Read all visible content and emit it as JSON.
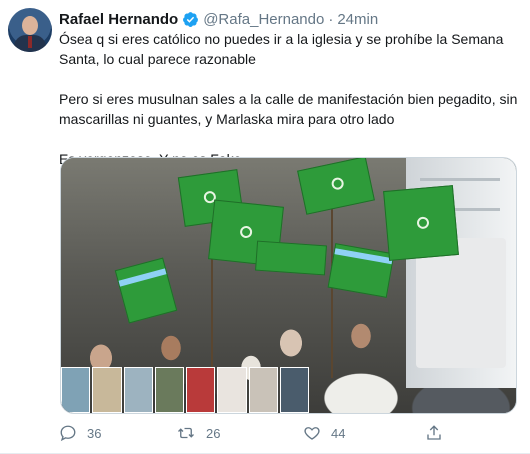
{
  "tweet": {
    "author_name": "Rafael Hernando",
    "handle": "@Rafa_Hernando",
    "separator": "·",
    "time": "24min",
    "paragraphs": [
      "Ósea q si eres católico no puedes ir a la iglesia y se prohíbe la Semana Santa, lo cual parece razonable",
      "Pero si eres musulnan sales a la calle de manifestación bien pegadito, sin mascarillas ni guantes, y Marlaska mira para  otro lado",
      "Es vergonzoso. Y no es Fake"
    ]
  },
  "actions": {
    "reply_count": "36",
    "retweet_count": "26",
    "like_count": "44"
  },
  "colors": {
    "text": "#14171a",
    "secondary": "#657786",
    "verified": "#1da1f2",
    "border": "#e6ecf0",
    "flag_green": "#2e9b3a"
  },
  "icons": {
    "verified": "verified-badge-icon",
    "reply": "reply-icon",
    "retweet": "retweet-icon",
    "like": "heart-icon",
    "share": "share-icon"
  }
}
